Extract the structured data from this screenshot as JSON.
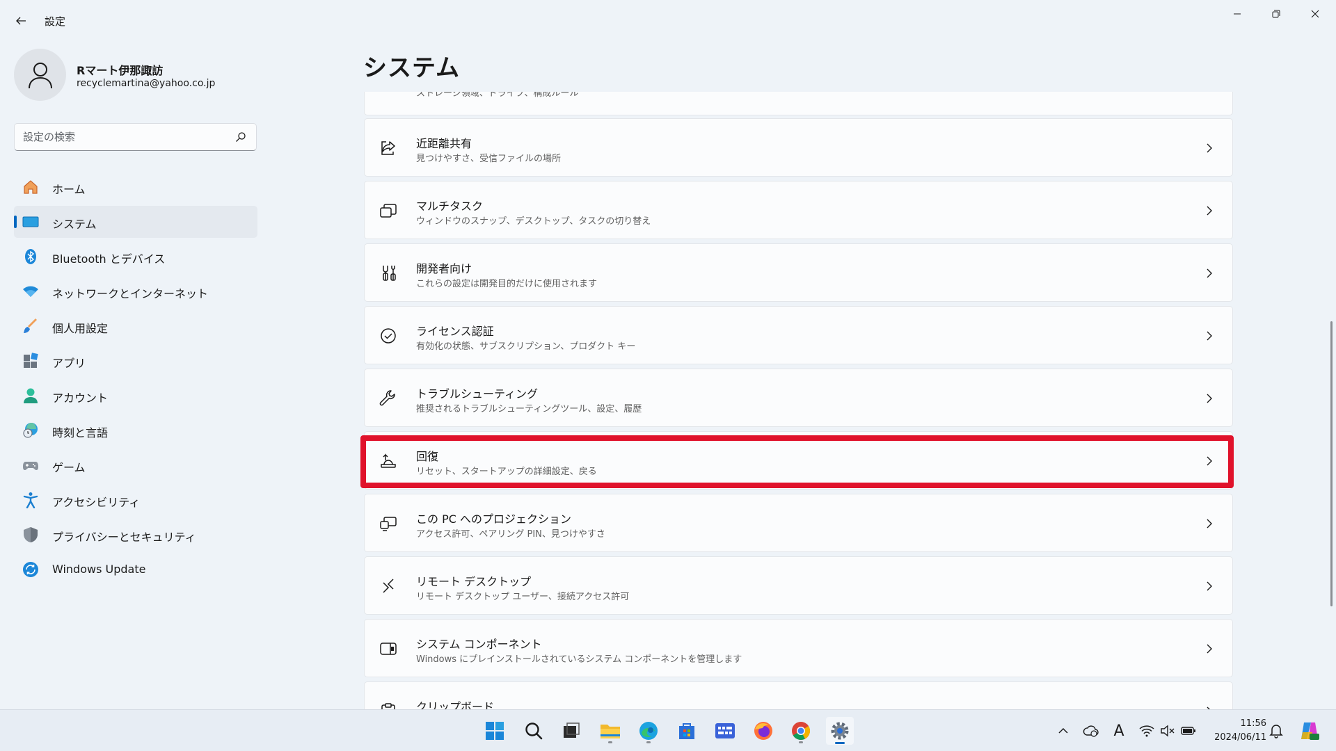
{
  "window": {
    "title": "設定",
    "back_icon": "arrow-left-icon",
    "controls": [
      "minimize-icon",
      "maximize-icon",
      "close-icon"
    ]
  },
  "profile": {
    "name": "Rマート伊那諏訪",
    "email": "recyclemartina@yahoo.co.jp",
    "avatar_icon": "person-icon"
  },
  "search": {
    "placeholder": "設定の検索",
    "value": "",
    "icon": "search-icon"
  },
  "sidebar": {
    "items": [
      {
        "label": "ホーム",
        "icon": "home-icon",
        "active": false
      },
      {
        "label": "システム",
        "icon": "system-monitor-icon",
        "active": true
      },
      {
        "label": "Bluetooth とデバイス",
        "icon": "bluetooth-icon",
        "active": false
      },
      {
        "label": "ネットワークとインターネット",
        "icon": "wifi-icon",
        "active": false
      },
      {
        "label": "個人用設定",
        "icon": "brush-icon",
        "active": false
      },
      {
        "label": "アプリ",
        "icon": "apps-icon",
        "active": false
      },
      {
        "label": "アカウント",
        "icon": "account-icon",
        "active": false
      },
      {
        "label": "時刻と言語",
        "icon": "globe-clock-icon",
        "active": false
      },
      {
        "label": "ゲーム",
        "icon": "gamepad-icon",
        "active": false
      },
      {
        "label": "アクセシビリティ",
        "icon": "accessibility-icon",
        "active": false
      },
      {
        "label": "プライバシーとセキュリティ",
        "icon": "shield-icon",
        "active": false
      },
      {
        "label": "Windows Update",
        "icon": "update-icon",
        "active": false
      }
    ]
  },
  "main": {
    "title": "システム",
    "partial_top_subtitle": "ストレージ領域、ドライブ、構成ルール",
    "items": [
      {
        "title": "近距離共有",
        "subtitle": "見つけやすさ、受信ファイルの場所",
        "icon": "share-icon"
      },
      {
        "title": "マルチタスク",
        "subtitle": "ウィンドウのスナップ、デスクトップ、タスクの切り替え",
        "icon": "multitask-icon"
      },
      {
        "title": "開発者向け",
        "subtitle": "これらの設定は開発目的だけに使用されます",
        "icon": "developer-tools-icon"
      },
      {
        "title": "ライセンス認証",
        "subtitle": "有効化の状態、サブスクリプション、プロダクト キー",
        "icon": "check-circle-icon"
      },
      {
        "title": "トラブルシューティング",
        "subtitle": "推奨されるトラブルシューティングツール、設定、履歴",
        "icon": "wrench-icon"
      },
      {
        "title": "回復",
        "subtitle": "リセット、スタートアップの詳細設定、戻る",
        "icon": "recovery-icon"
      },
      {
        "title": "この PC へのプロジェクション",
        "subtitle": "アクセス許可、ペアリング PIN、見つけやすさ",
        "icon": "projection-icon"
      },
      {
        "title": "リモート デスクトップ",
        "subtitle": "リモート デスクトップ ユーザー、接続アクセス許可",
        "icon": "remote-desktop-icon"
      },
      {
        "title": "システム コンポーネント",
        "subtitle": "Windows にプレインストールされているシステム コンポーネントを管理します",
        "icon": "components-icon"
      },
      {
        "title": "クリップボード",
        "subtitle": "",
        "icon": "clipboard-icon"
      }
    ],
    "highlighted_item": "回復"
  },
  "taskbar": {
    "apps": [
      "start-icon",
      "search-icon",
      "task-view-icon",
      "file-explorer-icon",
      "edge-icon",
      "store-icon",
      "widgets-app-icon",
      "firefox-icon",
      "chrome-icon",
      "settings-icon"
    ],
    "tray": [
      "chevron-up-icon",
      "onedrive-icon",
      "ime-icon",
      "wifi-icon",
      "volume-mute-icon",
      "battery-icon",
      "notification-icon",
      "copilot-icon"
    ],
    "ime_label": "A",
    "time": "11:56",
    "date": "2024/06/11"
  },
  "colors": {
    "accent": "#0067c0",
    "highlight_border": "#e0122b",
    "background": "#eef3f8",
    "card": "#fbfcfd"
  }
}
